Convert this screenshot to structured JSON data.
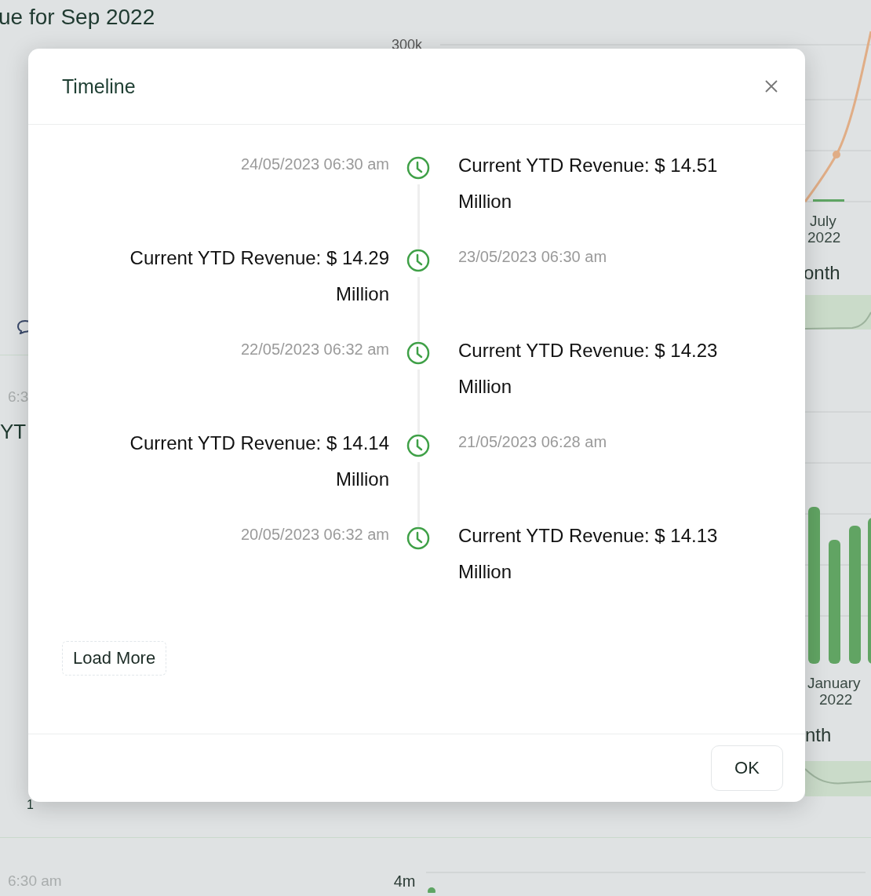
{
  "background": {
    "heading": "ue for Sep 2022",
    "card_1": {
      "time": "6:3",
      "title": "YT",
      "comment_count": "1"
    },
    "card_2": {
      "time": "6:30 am"
    },
    "chart_1": {
      "y_tick": "300k",
      "x_label": [
        "July",
        "2022"
      ],
      "axis_title": "onth"
    },
    "chart_2": {
      "x_label": [
        "January",
        "2022"
      ],
      "axis_title": "nth"
    },
    "chart_3": {
      "y_tick": "4m"
    }
  },
  "dialog": {
    "title": "Timeline",
    "events": [
      {
        "time": "24/05/2023 06:30 am",
        "text": "Current YTD Revenue: $ 14.51 Million"
      },
      {
        "time": "23/05/2023 06:30 am",
        "text": "Current YTD Revenue: $ 14.29 Million"
      },
      {
        "time": "22/05/2023 06:32 am",
        "text": "Current YTD Revenue: $ 14.23 Million"
      },
      {
        "time": "21/05/2023 06:28 am",
        "text": "Current YTD Revenue: $ 14.14 Million"
      },
      {
        "time": "20/05/2023 06:32 am",
        "text": "Current YTD Revenue: $ 14.13 Million"
      }
    ],
    "load_more": "Load More",
    "ok": "OK"
  }
}
